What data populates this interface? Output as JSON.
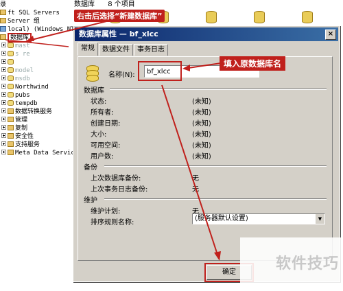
{
  "tree": {
    "items": [
      {
        "label": "录",
        "icon": "none-icon",
        "expand": false,
        "faded": false
      },
      {
        "label": "ft SQL Servers",
        "icon": "folder-icon",
        "expand": false,
        "faded": false
      },
      {
        "label": "Server 组",
        "icon": "folder-icon",
        "expand": false,
        "faded": false
      },
      {
        "label": "local) (Windows NT)",
        "icon": "server-icon",
        "expand": false,
        "faded": false
      },
      {
        "label": "数据库",
        "icon": "folder-icon",
        "expand": false,
        "faded": false,
        "highlight": true
      },
      {
        "label": "mast",
        "icon": "database-icon",
        "expand": true,
        "faded": true
      },
      {
        "label": "s    re",
        "icon": "database-icon",
        "expand": true,
        "faded": true
      },
      {
        "label": "",
        "icon": "database-icon",
        "expand": true,
        "faded": true
      },
      {
        "label": "model",
        "icon": "database-icon",
        "expand": true,
        "faded": true
      },
      {
        "label": "msdb",
        "icon": "database-icon",
        "expand": true,
        "faded": true
      },
      {
        "label": "Northwind",
        "icon": "database-icon",
        "expand": true,
        "faded": false
      },
      {
        "label": "pubs",
        "icon": "database-icon",
        "expand": true,
        "faded": false
      },
      {
        "label": "tempdb",
        "icon": "database-icon",
        "expand": true,
        "faded": false
      },
      {
        "label": "数据转换服务",
        "icon": "folder-icon",
        "expand": true,
        "faded": false
      },
      {
        "label": "管理",
        "icon": "folder-icon",
        "expand": true,
        "faded": false
      },
      {
        "label": "复制",
        "icon": "folder-icon",
        "expand": true,
        "faded": false
      },
      {
        "label": "安全性",
        "icon": "folder-icon",
        "expand": true,
        "faded": false
      },
      {
        "label": "支持服务",
        "icon": "folder-icon",
        "expand": true,
        "faded": false
      },
      {
        "label": "Meta Data Services",
        "icon": "folder-icon",
        "expand": true,
        "faded": false
      }
    ]
  },
  "list": {
    "title": "数据库",
    "count": "8 个项目"
  },
  "annotations": {
    "right_click": "右击后选择“新建数据库”",
    "enter_name": "填入原数据库名",
    "color": "#c0201c"
  },
  "dialog": {
    "title": "数据库属性 — bf_xlcc",
    "close": "×",
    "tabs": [
      "常规",
      "数据文件",
      "事务日志"
    ],
    "name_label": "名称(N):",
    "name_value": "bf_xlcc",
    "groups": {
      "database": {
        "title": "数据库",
        "rows": [
          {
            "label": "状态:",
            "value": "(未知)"
          },
          {
            "label": "所有者:",
            "value": "(未知)"
          },
          {
            "label": "创建日期:",
            "value": "(未知)"
          },
          {
            "label": "大小:",
            "value": "(未知)"
          },
          {
            "label": "可用空间:",
            "value": "(未知)"
          },
          {
            "label": "用户数:",
            "value": "(未知)"
          }
        ]
      },
      "backup": {
        "title": "备份",
        "rows": [
          {
            "label": "上次数据库备份:",
            "value": "无"
          },
          {
            "label": "上次事务日志备份:",
            "value": "无"
          }
        ]
      },
      "maintenance": {
        "title": "维护",
        "rows": [
          {
            "label": "维护计划:",
            "value": "无"
          },
          {
            "label": "排序规则名称:",
            "value": "(服务器默认设置)"
          }
        ]
      }
    },
    "ok_label": "确定"
  },
  "watermark": "软件技巧"
}
